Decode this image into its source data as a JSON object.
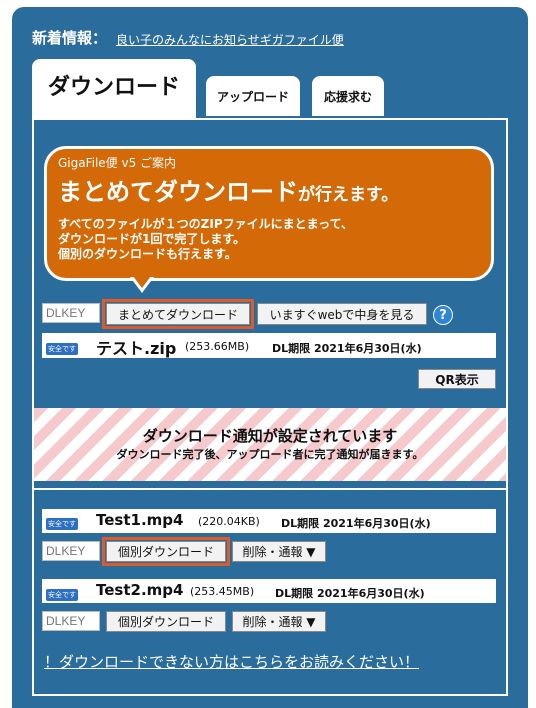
{
  "header": {
    "news_label": "新着情報：",
    "news_link": "良い子のみんなにお知らせギガファイル便"
  },
  "tabs": [
    {
      "label": "ダウンロード",
      "active": true
    },
    {
      "label": "アップロード",
      "active": false
    },
    {
      "label": "応援求む",
      "active": false
    }
  ],
  "bubble": {
    "subtitle": "GigaFile便 v5 ご案内",
    "title_main": "まとめてダウンロード",
    "title_tail": "が行えます。",
    "lines": [
      "すべてのファイルが１つのZIPファイルにまとまって、",
      "ダウンロードが1回で完了します。",
      "個別のダウンロードも行えます。"
    ]
  },
  "bulk": {
    "dlkey_placeholder": "DLKEY",
    "download_button": "まとめてダウンロード",
    "web_button": "いますぐwebで中身を見る",
    "help_icon": "?",
    "badge": "安全です",
    "file_name": "テスト.zip",
    "size": "(253.66MB)",
    "limit": "DL期限 2021年6月30日(水)",
    "qr_button": "QR表示"
  },
  "notice": {
    "title": "ダウンロード通知が設定されています",
    "body": "ダウンロード完了後、アップロード者に完了通知が届きます。"
  },
  "files": [
    {
      "badge": "安全です",
      "name": "Test1.mp4",
      "size": "(220.04KB)",
      "limit": "DL期限 2021年6月30日(水)",
      "dlkey_placeholder": "DLKEY",
      "download_button": "個別ダウンロード",
      "menu_button": "削除・通報 ▼"
    },
    {
      "badge": "安全です",
      "name": "Test2.mp4",
      "size": "(253.45MB)",
      "limit": "DL期限 2021年6月30日(水)",
      "dlkey_placeholder": "DLKEY",
      "download_button": "個別ダウンロード",
      "menu_button": "削除・通報 ▼"
    }
  ],
  "footer": {
    "help_link": "！ダウンロードできない方はこちらをお読みください！"
  },
  "colors": {
    "panel": "#2a6c9c",
    "bubble": "#d36a07",
    "highlight": "#e05a28",
    "badge": "#2d6fc2"
  }
}
